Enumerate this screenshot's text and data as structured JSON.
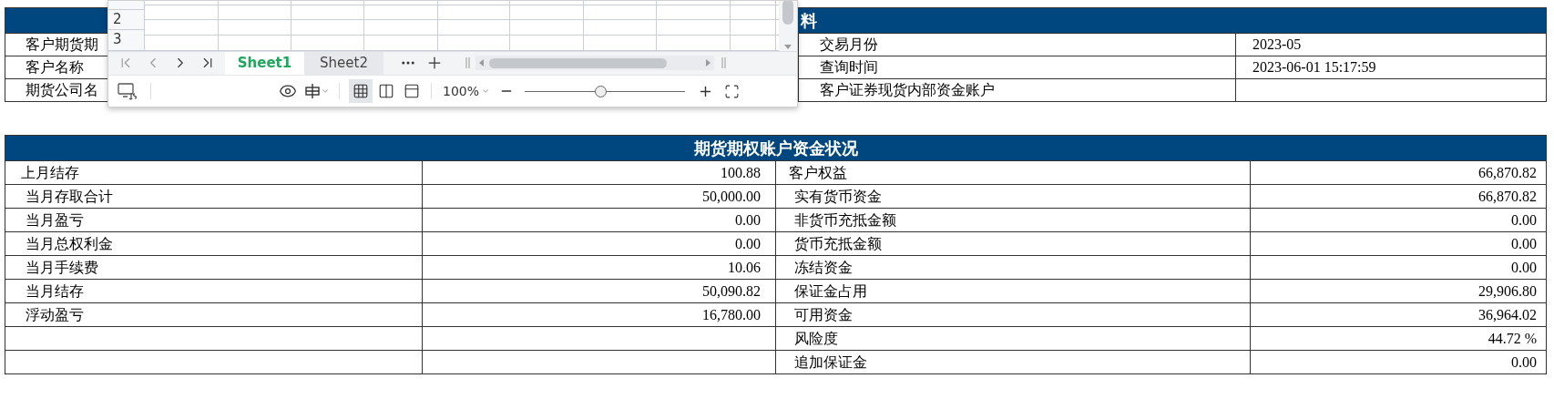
{
  "info_table": {
    "title": "料",
    "rows": [
      {
        "label": "客户期货期",
        "label_2": "交易月份",
        "value_2": "2023-05"
      },
      {
        "label": "客户名称",
        "label_2": "查询时间",
        "value_2": "2023-06-01 15:17:59"
      },
      {
        "label": "期货公司名",
        "label_2": "客户证券现货内部资金账户"
      }
    ]
  },
  "funds_table": {
    "title": "期货期权账户资金状况",
    "rows": [
      {
        "label": "上月结存",
        "value": "100.88",
        "label_2": "客户权益",
        "value_2": "66,870.82"
      },
      {
        "label": "当月存取合计",
        "value": "50,000.00",
        "label_2": "实有货币资金",
        "value_2": "66,870.82"
      },
      {
        "label": "当月盈亏",
        "value": "0.00",
        "label_2": "非货币充抵金额",
        "value_2": "0.00"
      },
      {
        "label": "当月总权利金",
        "value": "0.00",
        "label_2": "货币充抵金额",
        "value_2": "0.00"
      },
      {
        "label": "当月手续费",
        "value": "10.06",
        "label_2": "冻结资金",
        "value_2": "0.00"
      },
      {
        "label": "当月结存",
        "value": "50,090.82",
        "label_2": "保证金占用",
        "value_2": "29,906.80"
      },
      {
        "label": "浮动盈亏",
        "value": "16,780.00",
        "label_2": "可用资金",
        "value_2": "36,964.02"
      },
      {
        "label_2": "风险度",
        "value_2": "44.72 %"
      },
      {
        "label_2": "追加保证金",
        "value_2": "0.00"
      }
    ]
  },
  "spreadsheet_popup": {
    "row_numbers": [
      "2",
      "3"
    ],
    "sheet_tabs": [
      {
        "label": "Sheet1",
        "selected": true
      },
      {
        "label": "Sheet2",
        "selected": false
      }
    ],
    "zoom_text": "100%",
    "zoom_slider": {
      "level": 0.47
    }
  }
}
